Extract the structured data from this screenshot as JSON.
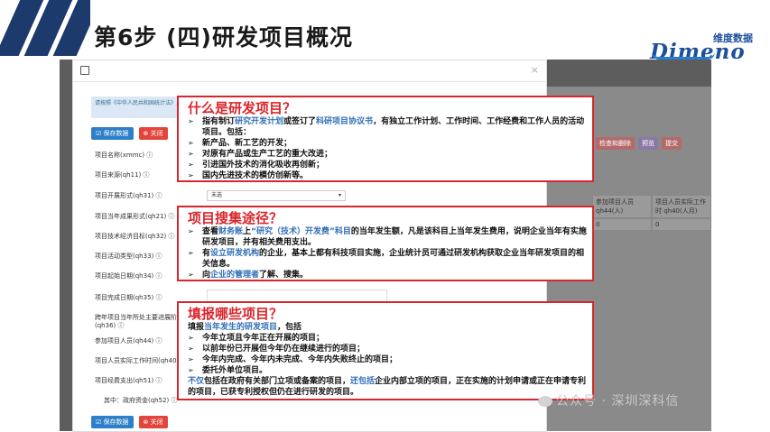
{
  "slide": {
    "title": "第6步  (四)研发项目概况",
    "logo_cn": "维度数据",
    "logo_en": "Dimeno",
    "colors": {
      "accent_red": "#d9262c",
      "brand_blue": "#1c3a6b",
      "highlight_blue": "#2f6fb7"
    }
  },
  "background_app": {
    "actions": [
      "检查和删除",
      "预览",
      "提交"
    ],
    "table_headers": [
      "参加项目人员 qh44(人)",
      "项目人员实际工作时 qh40(人月)"
    ],
    "table_values": [
      "0",
      "0"
    ]
  },
  "modal": {
    "notice": "请按照《中华人民共和国统计法》... 要求。",
    "save_label": "保存数据",
    "close_label": "关闭",
    "select_value": "未选",
    "fields": [
      "项目名称(xmmc) ⓘ",
      "项目来源(qh11) ⓘ",
      "项目开展形式(qh31) ⓘ",
      "项目当年成果形式(qh21) ⓘ",
      "项目技术经济目标(qh32) ⓘ",
      "项目活动类型(qh33) ⓘ",
      "项目起始日期(qh34) ⓘ",
      "项目完成日期(qh35) ⓘ",
      "跨年项目当年所处主要进展阶段",
      "(qh36) ⓘ",
      "参加项目人员(qh44) ⓘ",
      "项目人员实际工作时间(qh40) ⓘ",
      "项目经费支出(qh51) ⓘ",
      "其中：政府资金(qh52) ⓘ"
    ]
  },
  "callouts": {
    "what": {
      "title": "什么是研发项目？",
      "items": [
        {
          "pre": "指有制订",
          "hl": "研究开发计划",
          "mid": "或签订了",
          "hl2": "科研项目协议书",
          "post": "，有独立工作计划、工作时间、工作经费和工作人员的活动项目。包括："
        },
        {
          "pre": "新产品、新工艺的开发；"
        },
        {
          "pre": "对原有产品或生产工艺的重大改进；"
        },
        {
          "pre": "引进国外技术的消化吸收再创新；"
        },
        {
          "pre": "国内先进技术的模仿创新等。"
        }
      ]
    },
    "how": {
      "title": "项目搜集途径？",
      "items": [
        {
          "pre": "查看",
          "hl": "财务账",
          "mid": "上",
          "hl2": "“研究（技术）开发费”科目",
          "post": "的当年发生额，凡是该科目上当年发生费用，说明企业当年有实施研发项目，并有相关费用支出。"
        },
        {
          "pre": "有",
          "hl": "设立研发机构",
          "post": "的企业，基本上都有科技项目实施，企业统计员可通过研发机构获取企业当年研发项目的相关信息。"
        },
        {
          "pre": "向",
          "hl": "企业的管理者",
          "post": "了解、搜集。"
        }
      ]
    },
    "which": {
      "title": "填报哪些项目？",
      "intro_pre": "填报",
      "intro_hl": "当年发生的研发项目",
      "intro_post": "，包括",
      "items": [
        "今年立项且今年正在开展的项目；",
        "以前年份已开展但今年仍在继续进行的项目；",
        "今年内完成、今年内未完成、今年内失败终止的项目；",
        "委托外单位项目。"
      ],
      "footer_hl": "不仅",
      "footer_a": "包括在政府有关部门立项或备案的项目，",
      "footer_hl2": "还包括",
      "footer_b": "企业内部立项的项目，正在实施的计划申请或正在申请专利的项目，已获专利授权但仍在进行研发的项目。"
    }
  },
  "watermark": "公众号 · 深圳深科信",
  "bullet_glyph": "➢"
}
